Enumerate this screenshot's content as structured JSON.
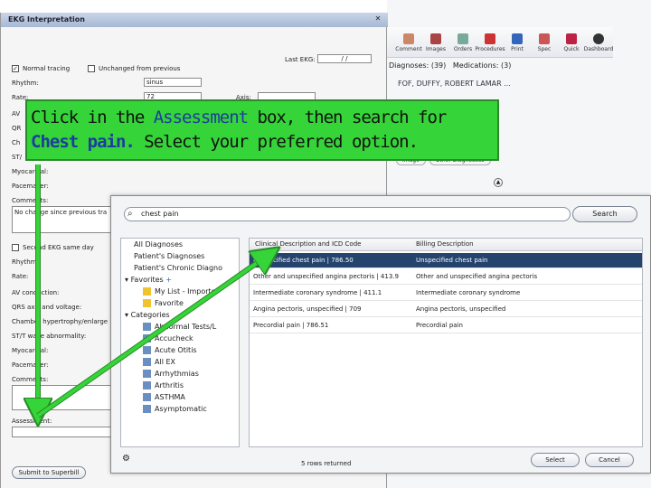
{
  "ehr": {
    "toolbar": [
      "Comment",
      "Images",
      "Orders",
      "Procedures",
      "Print",
      "Spec",
      "Quick",
      "Dashboard"
    ],
    "diagnoses_label": "Diagnoses: (39)",
    "medications_label": "Medications: (3)",
    "patient_name": "FOF, DUFFY, ROBERT LAMAR ...",
    "summary_link": "mmary",
    "pill_image": "Image",
    "pill_other": "Other Diagnostics"
  },
  "ekg": {
    "title": "EKG Interpretation",
    "last_ekg_label": "Last EKG:",
    "last_ekg_value": "/ /",
    "normal_tracing": "Normal tracing",
    "unchanged": "Unchanged from previous",
    "rhythm_label": "Rhythm:",
    "rhythm_value": "sinus",
    "rate_label": "Rate:",
    "rate_value": "72",
    "axis_label": "Axis:",
    "row_labels": [
      "AV",
      "QR",
      "Ch",
      "ST/",
      "Myocardial:",
      "Pacemaker:"
    ],
    "comments_label": "Comments:",
    "comments_value": "No change since previous tra",
    "second_ekg": "Second EKG same day",
    "second_labels": [
      "Rhythm:",
      "Rate:",
      "AV conduction:",
      "QRS axis and voltage:",
      "Chamber hypertrophy/enlarge",
      "ST/T wave abnormality:",
      "Myocardial:",
      "Pacemaker:",
      "Comments:"
    ],
    "assessment_label": "Assessment:",
    "submit": "Submit to Superbill"
  },
  "search": {
    "query": "chest pain",
    "button": "Search",
    "tree": [
      "All Diagnoses",
      "Patient's Diagnoses",
      "Patient's Chronic Diagno",
      "Favorites",
      "My List - Importe",
      "Favorite",
      "Categories",
      "Abnormal Tests/L",
      "Accucheck",
      "Acute Otitis",
      "All EX",
      "Arrhythmias",
      "Arthritis",
      "ASTHMA",
      "Asymptomatic"
    ],
    "col1": "Clinical Description and ICD Code",
    "col2": "Billing Description",
    "rows": [
      {
        "clin": "Unspecified chest pain | 786.50",
        "bill": "Unspecified chest pain"
      },
      {
        "clin": "Other and unspecified angina pectoris | 413.9",
        "bill": "Other and unspecified angina pectoris"
      },
      {
        "clin": "Intermediate coronary syndrome | 411.1",
        "bill": "Intermediate coronary syndrome"
      },
      {
        "clin": "Angina pectoris, unspecified | 709",
        "bill": "Angina pectoris, unspecified"
      },
      {
        "clin": "Precordial pain | 786.51",
        "bill": "Precordial pain"
      }
    ],
    "rows_returned": "5 rows returned",
    "select": "Select",
    "cancel": "Cancel"
  },
  "callout": {
    "line1_a": "Click in the ",
    "line1_b": "Assessment",
    "line1_c": " box, then search for",
    "line2_a": "Chest pain.",
    "line2_b": "  Select your preferred option."
  },
  "colors": {
    "callout": "#35d438",
    "selected_row": "#24446d",
    "highlight_text": "#1d3c9e"
  }
}
